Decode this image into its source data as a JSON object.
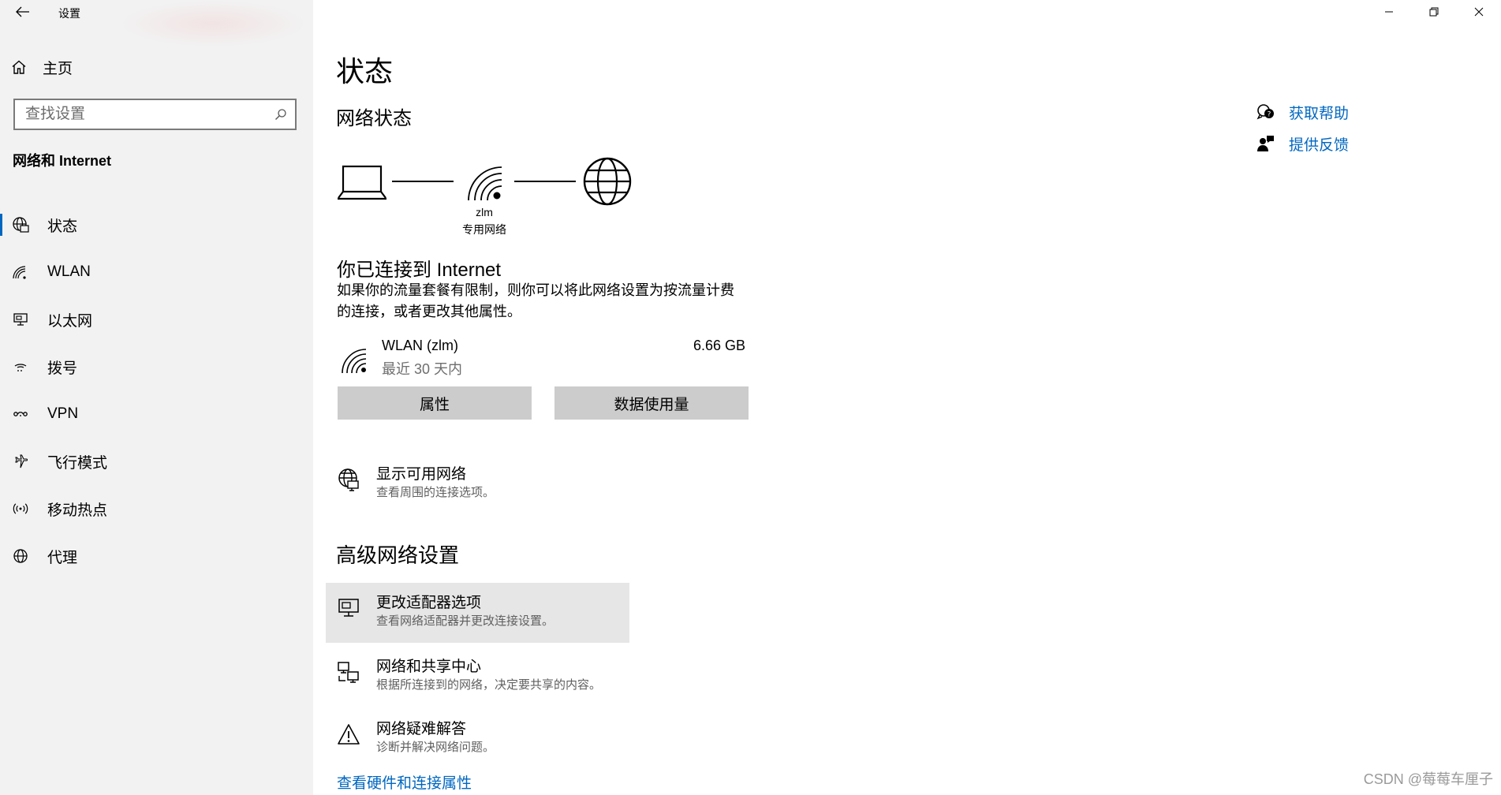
{
  "window": {
    "title": "设置"
  },
  "sidebar": {
    "home_label": "主页",
    "search_placeholder": "查找设置",
    "section_title": "网络和 Internet",
    "items": [
      {
        "label": "状态",
        "icon": "globe-status-icon",
        "active": true
      },
      {
        "label": "WLAN",
        "icon": "wifi-icon"
      },
      {
        "label": "以太网",
        "icon": "ethernet-icon"
      },
      {
        "label": "拨号",
        "icon": "dialup-icon"
      },
      {
        "label": "VPN",
        "icon": "vpn-icon"
      },
      {
        "label": "飞行模式",
        "icon": "airplane-icon"
      },
      {
        "label": "移动热点",
        "icon": "hotspot-icon"
      },
      {
        "label": "代理",
        "icon": "proxy-globe-icon"
      }
    ]
  },
  "main": {
    "page_title": "状态",
    "network_status_heading": "网络状态",
    "diagram": {
      "network_name": "zlm",
      "network_type": "专用网络"
    },
    "connected_heading": "你已连接到 Internet",
    "connected_description": "如果你的流量套餐有限制，则你可以将此网络设置为按流量计费的连接，或者更改其他属性。",
    "connection": {
      "name": "WLAN (zlm)",
      "period": "最近 30 天内",
      "usage": "6.66 GB"
    },
    "buttons": {
      "properties": "属性",
      "data_usage": "数据使用量"
    },
    "show_available": {
      "title": "显示可用网络",
      "subtitle": "查看周围的连接选项。"
    },
    "advanced_heading": "高级网络设置",
    "advanced_items": [
      {
        "title": "更改适配器选项",
        "subtitle": "查看网络适配器并更改连接设置。"
      },
      {
        "title": "网络和共享中心",
        "subtitle": "根据所连接到的网络，决定要共享的内容。"
      },
      {
        "title": "网络疑难解答",
        "subtitle": "诊断并解决网络问题。"
      }
    ],
    "hardware_link": "查看硬件和连接属性"
  },
  "help": {
    "get_help": "获取帮助",
    "feedback": "提供反馈"
  },
  "watermark": "CSDN @莓莓车厘子",
  "colors": {
    "accent": "#0067c0",
    "sidebar_bg": "#f2f2f2",
    "button_bg": "#cccccc",
    "hover_bg": "#e6e6e6"
  }
}
